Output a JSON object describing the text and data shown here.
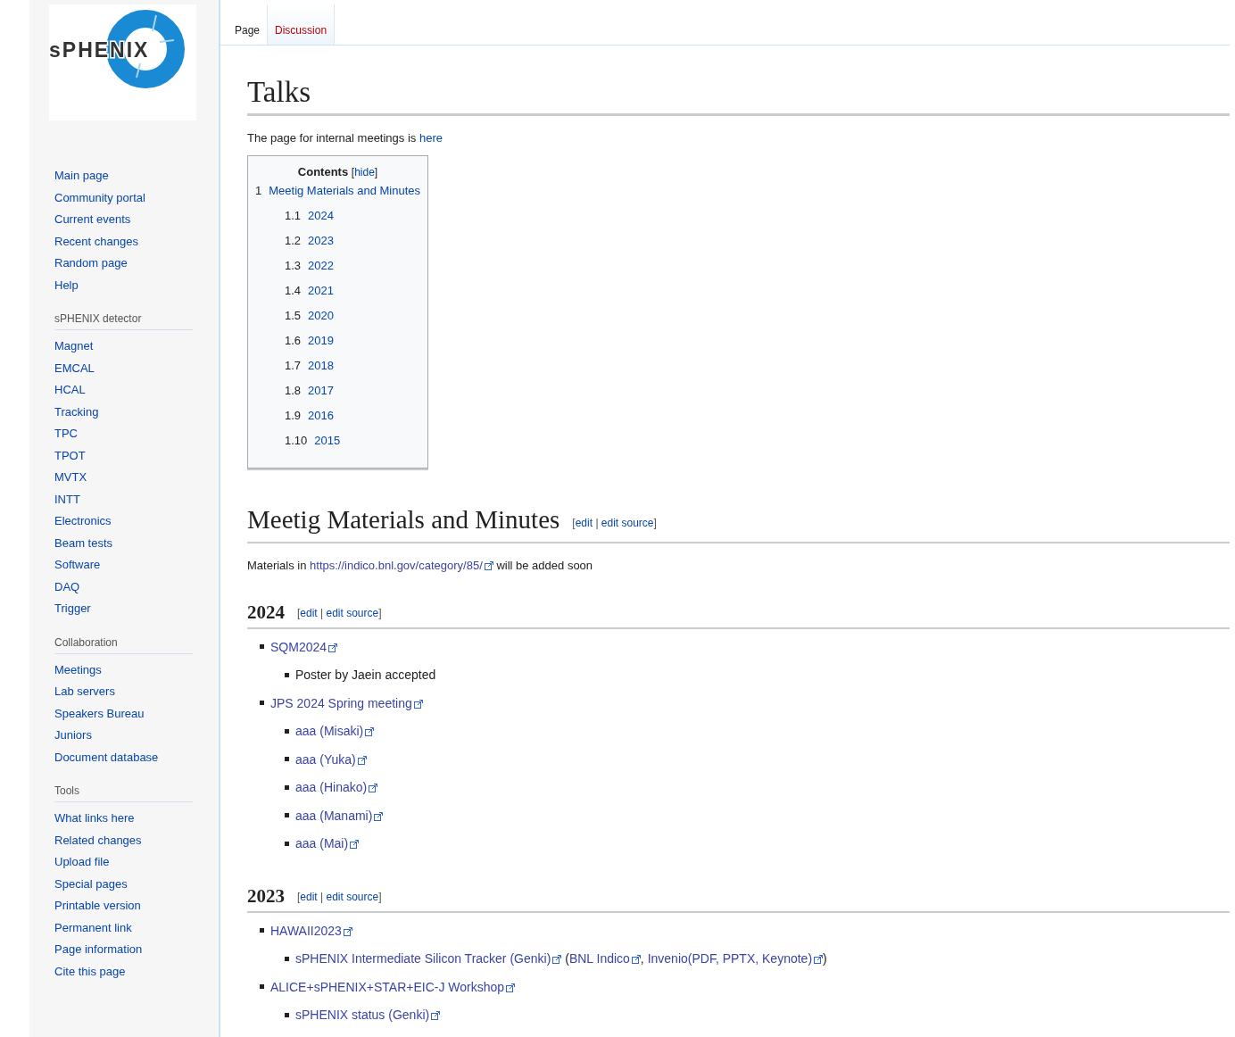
{
  "logo": {
    "text": "sPHENIX"
  },
  "tabs": [
    {
      "label": "Page",
      "selected": true,
      "missing": false
    },
    {
      "label": "Discussion",
      "selected": false,
      "missing": true
    }
  ],
  "sidebar": {
    "groups": [
      {
        "items": [
          "Main page",
          "Community portal",
          "Current events",
          "Recent changes",
          "Random page",
          "Help"
        ]
      },
      {
        "heading": "sPHENIX detector",
        "items": [
          "Magnet",
          "EMCAL",
          "HCAL",
          "Tracking",
          "TPC",
          "TPOT",
          "MVTX",
          "INTT",
          "Electronics",
          "Beam tests",
          "Software",
          "DAQ",
          "Trigger"
        ]
      },
      {
        "heading": "Collaboration",
        "items": [
          "Meetings",
          "Lab servers",
          "Speakers Bureau",
          "Juniors",
          "Document database"
        ]
      },
      {
        "heading": "Tools",
        "items": [
          "What links here",
          "Related changes",
          "Upload file",
          "Special pages",
          "Printable version",
          "Permanent link",
          "Page information",
          "Cite this page"
        ]
      }
    ]
  },
  "page": {
    "title": "Talks",
    "intro": [
      {
        "text": "The page for internal meetings is "
      },
      {
        "text": "here",
        "link": true,
        "external": false
      }
    ],
    "toc": {
      "title": "Contents",
      "toggle": [
        {
          "text": "["
        },
        {
          "text": "hide",
          "link": true,
          "external": false
        },
        {
          "text": "]"
        }
      ],
      "items": [
        {
          "number": "1",
          "text": "Meetig Materials and Minutes",
          "children": [
            {
              "number": "1.1",
              "text": "2024"
            },
            {
              "number": "1.2",
              "text": "2023"
            },
            {
              "number": "1.3",
              "text": "2022"
            },
            {
              "number": "1.4",
              "text": "2021"
            },
            {
              "number": "1.5",
              "text": "2020"
            },
            {
              "number": "1.6",
              "text": "2019"
            },
            {
              "number": "1.7",
              "text": "2018"
            },
            {
              "number": "1.8",
              "text": "2017"
            },
            {
              "number": "1.9",
              "text": "2016"
            },
            {
              "number": "1.10",
              "text": "2015"
            }
          ]
        }
      ]
    },
    "sections": [
      {
        "kind": "h2",
        "title": "Meetig Materials and Minutes",
        "edit": [
          {
            "text": "["
          },
          {
            "text": "edit",
            "link": true,
            "external": false
          },
          {
            "text": " | "
          },
          {
            "text": "edit source",
            "link": true,
            "external": false
          },
          {
            "text": "]"
          }
        ],
        "paragraph": [
          {
            "text": "Materials in "
          },
          {
            "text": "https://indico.bnl.gov/category/85/",
            "link": true,
            "external": true
          },
          {
            "text": " will be added soon"
          }
        ]
      },
      {
        "kind": "h3",
        "title": "2024",
        "edit": [
          {
            "text": "["
          },
          {
            "text": "edit",
            "link": true,
            "external": false
          },
          {
            "text": " | "
          },
          {
            "text": "edit source",
            "link": true,
            "external": false
          },
          {
            "text": "]"
          }
        ],
        "list": [
          {
            "parts": [
              {
                "text": "SQM2024",
                "link": true,
                "external": true
              }
            ],
            "children": [
              {
                "parts": [
                  {
                    "text": "Poster by Jaein accepted"
                  }
                ]
              }
            ]
          },
          {
            "parts": [
              {
                "text": "JPS 2024 Spring meeting",
                "link": true,
                "external": true
              }
            ],
            "children": [
              {
                "parts": [
                  {
                    "text": "aaa (Misaki)",
                    "link": true,
                    "external": true
                  }
                ]
              },
              {
                "parts": [
                  {
                    "text": "aaa (Yuka)",
                    "link": true,
                    "external": true
                  }
                ]
              },
              {
                "parts": [
                  {
                    "text": "aaa (Hinako)",
                    "link": true,
                    "external": true
                  }
                ]
              },
              {
                "parts": [
                  {
                    "text": "aaa (Manami)",
                    "link": true,
                    "external": true
                  }
                ]
              },
              {
                "parts": [
                  {
                    "text": "aaa (Mai)",
                    "link": true,
                    "external": true
                  }
                ]
              }
            ]
          }
        ]
      },
      {
        "kind": "h3",
        "title": "2023",
        "edit": [
          {
            "text": "["
          },
          {
            "text": "edit",
            "link": true,
            "external": false
          },
          {
            "text": " | "
          },
          {
            "text": "edit source",
            "link": true,
            "external": false
          },
          {
            "text": "]"
          }
        ],
        "list": [
          {
            "parts": [
              {
                "text": "HAWAII2023",
                "link": true,
                "external": true
              }
            ],
            "children": [
              {
                "parts": [
                  {
                    "text": "sPHENIX Intermediate Silicon Tracker (Genki)",
                    "link": true,
                    "external": true
                  },
                  {
                    "text": " ("
                  },
                  {
                    "text": "BNL Indico",
                    "link": true,
                    "external": true
                  },
                  {
                    "text": ", "
                  },
                  {
                    "text": "Invenio(PDF, PPTX, Keynote)",
                    "link": true,
                    "external": true
                  },
                  {
                    "text": ")"
                  }
                ]
              }
            ]
          },
          {
            "parts": [
              {
                "text": "ALICE+sPHENIX+STAR+EIC-J Workshop",
                "link": true,
                "external": true
              }
            ],
            "children": [
              {
                "parts": [
                  {
                    "text": "sPHENIX status (Genki)",
                    "link": true,
                    "external": true
                  }
                ]
              }
            ]
          }
        ]
      }
    ]
  }
}
